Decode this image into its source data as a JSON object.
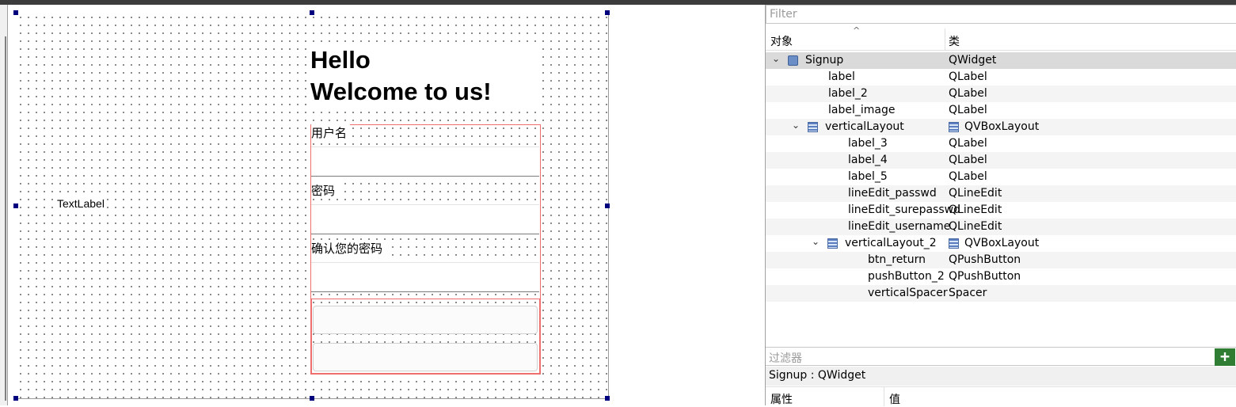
{
  "form": {
    "text_label": "TextLabel",
    "heading_line1": "Hello",
    "heading_line2": "Welcome to us!",
    "field_labels": [
      "用户名",
      "密码",
      "确认您的密码"
    ],
    "button_labels": [
      "",
      ""
    ]
  },
  "object_inspector": {
    "filter_placeholder": "Filter",
    "header_object": "对象",
    "header_class": "类",
    "rows": [
      {
        "name": "Signup",
        "cls": "QWidget",
        "depth": 0,
        "expandable": true,
        "icon": "widget-icon"
      },
      {
        "name": "label",
        "cls": "QLabel",
        "depth": 1
      },
      {
        "name": "label_2",
        "cls": "QLabel",
        "depth": 1
      },
      {
        "name": "label_image",
        "cls": "QLabel",
        "depth": 1
      },
      {
        "name": "verticalLayout",
        "cls": "QVBoxLayout",
        "depth": 1,
        "expandable": true,
        "icon": "layout-icon"
      },
      {
        "name": "label_3",
        "cls": "QLabel",
        "depth": 2
      },
      {
        "name": "label_4",
        "cls": "QLabel",
        "depth": 2
      },
      {
        "name": "label_5",
        "cls": "QLabel",
        "depth": 2
      },
      {
        "name": "lineEdit_passwd",
        "cls": "QLineEdit",
        "depth": 2
      },
      {
        "name": "lineEdit_surepasswd",
        "cls": "QLineEdit",
        "depth": 2
      },
      {
        "name": "lineEdit_username",
        "cls": "QLineEdit",
        "depth": 2
      },
      {
        "name": "verticalLayout_2",
        "cls": "QVBoxLayout",
        "depth": 2,
        "expandable": true,
        "icon": "layout-icon"
      },
      {
        "name": "btn_return",
        "cls": "QPushButton",
        "depth": 3
      },
      {
        "name": "pushButton_2",
        "cls": "QPushButton",
        "depth": 3
      },
      {
        "name": "verticalSpacer",
        "cls": "Spacer",
        "depth": 3
      }
    ]
  },
  "property_editor": {
    "filter_placeholder": "过滤器",
    "add_icon": "plus-icon",
    "object_caption": "Signup : QWidget",
    "header_property": "属性",
    "header_value": "值"
  },
  "colors": {
    "selection_handle": "#00007f",
    "layout_border": "#ef6e6e",
    "selected_row": "#dadada",
    "add_button": "#2e7d32"
  }
}
